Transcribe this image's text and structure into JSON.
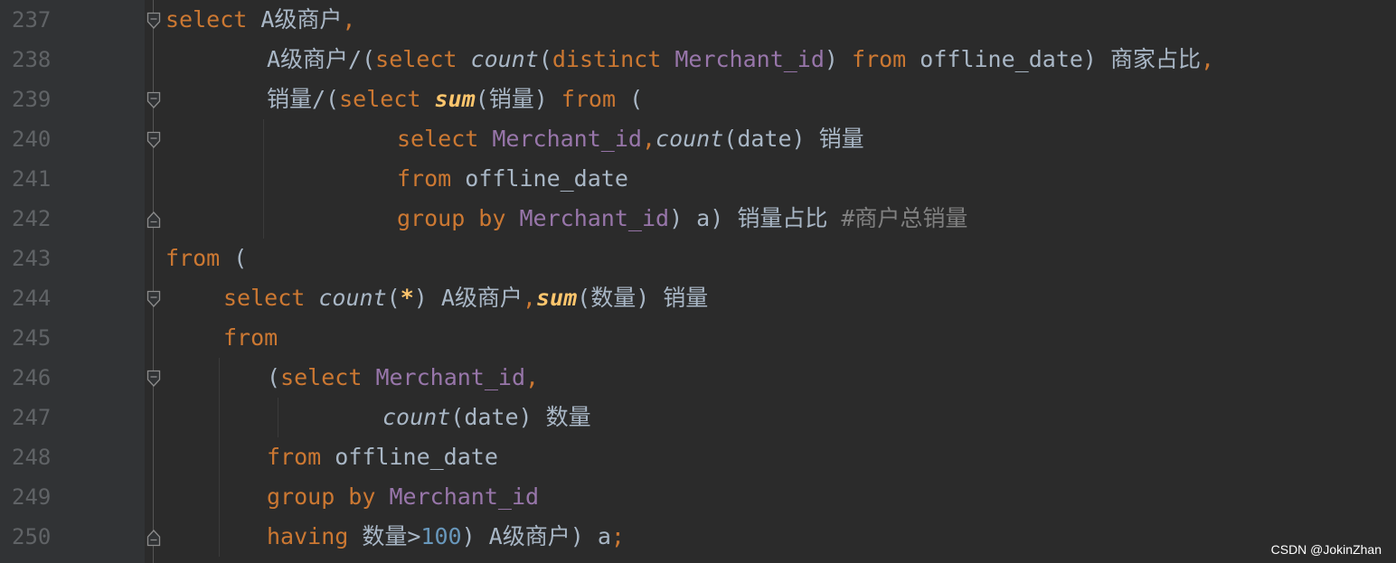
{
  "editor": {
    "lines": [
      {
        "num": "237",
        "fold": "start",
        "indent": 0,
        "tokens": [
          [
            "select",
            "kw"
          ],
          [
            " A级商户",
            "txt"
          ],
          [
            ",",
            "kw"
          ]
        ]
      },
      {
        "num": "238",
        "fold": "",
        "indent": 2,
        "tokens": [
          [
            "A级商户/(",
            "txt"
          ],
          [
            "select",
            "kw"
          ],
          [
            " ",
            "txt"
          ],
          [
            "count",
            "fn"
          ],
          [
            "(",
            "txt"
          ],
          [
            "distinct",
            "kw"
          ],
          [
            " ",
            "txt"
          ],
          [
            "Merchant_id",
            "col"
          ],
          [
            ") ",
            "txt"
          ],
          [
            "from",
            "kw"
          ],
          [
            " offline_date) 商家占比",
            "txt"
          ],
          [
            ",",
            "kw"
          ]
        ]
      },
      {
        "num": "239",
        "fold": "start",
        "indent": 2,
        "tokens": [
          [
            "销量/(",
            "txt"
          ],
          [
            "select",
            "kw"
          ],
          [
            " ",
            "txt"
          ],
          [
            "sum",
            "fa"
          ],
          [
            "(销量) ",
            "txt"
          ],
          [
            "from",
            "kw"
          ],
          [
            " (",
            "txt"
          ]
        ]
      },
      {
        "num": "240",
        "fold": "start",
        "indent": 4,
        "tokens": [
          [
            "select",
            "kw"
          ],
          [
            " ",
            "txt"
          ],
          [
            "Merchant_id",
            "col"
          ],
          [
            ",",
            "kw"
          ],
          [
            "count",
            "fn"
          ],
          [
            "(date) 销量",
            "txt"
          ]
        ]
      },
      {
        "num": "241",
        "fold": "",
        "indent": 4,
        "tokens": [
          [
            "from",
            "kw"
          ],
          [
            " offline_date",
            "txt"
          ]
        ]
      },
      {
        "num": "242",
        "fold": "end",
        "indent": 4,
        "tokens": [
          [
            "group by",
            "kw"
          ],
          [
            " ",
            "txt"
          ],
          [
            "Merchant_id",
            "col"
          ],
          [
            ") a) 销量占比 ",
            "txt"
          ],
          [
            "#商户总销量",
            "cmt"
          ]
        ]
      },
      {
        "num": "243",
        "fold": "",
        "indent": 0,
        "tokens": [
          [
            "from",
            "kw"
          ],
          [
            " (",
            "txt"
          ]
        ]
      },
      {
        "num": "244",
        "fold": "start",
        "indent": 1,
        "tokens": [
          [
            "select",
            "kw"
          ],
          [
            " ",
            "txt"
          ],
          [
            "count",
            "fn"
          ],
          [
            "(",
            "txt"
          ],
          [
            "*",
            "fa"
          ],
          [
            ") A级商户",
            "txt"
          ],
          [
            ",",
            "kw"
          ],
          [
            "sum",
            "fa"
          ],
          [
            "(数量) 销量",
            "txt"
          ]
        ]
      },
      {
        "num": "245",
        "fold": "",
        "indent": 1,
        "tokens": [
          [
            "from",
            "kw"
          ]
        ]
      },
      {
        "num": "246",
        "fold": "start",
        "indent": 2,
        "tokens": [
          [
            "(",
            "txt"
          ],
          [
            "select",
            "kw"
          ],
          [
            " ",
            "txt"
          ],
          [
            "Merchant_id",
            "col"
          ],
          [
            ",",
            "kw"
          ]
        ]
      },
      {
        "num": "247",
        "fold": "",
        "indent": 3,
        "tokens": [
          [
            "count",
            "fn"
          ],
          [
            "(date) 数量",
            "txt"
          ]
        ]
      },
      {
        "num": "248",
        "fold": "",
        "indent": 2,
        "tokens": [
          [
            "from",
            "kw"
          ],
          [
            " offline_date",
            "txt"
          ]
        ]
      },
      {
        "num": "249",
        "fold": "",
        "indent": 2,
        "tokens": [
          [
            "group by",
            "kw"
          ],
          [
            " ",
            "txt"
          ],
          [
            "Merchant_id",
            "col"
          ]
        ]
      },
      {
        "num": "250",
        "fold": "end",
        "indent": 2,
        "tokens": [
          [
            "having",
            "kw"
          ],
          [
            " 数量>",
            "txt"
          ],
          [
            "100",
            "num"
          ],
          [
            ") A级商户) a",
            "txt"
          ],
          [
            ";",
            "kw"
          ]
        ]
      }
    ]
  },
  "colors": {
    "background": "#2b2b2b",
    "gutter": "#313335",
    "keyword": "#cc7832",
    "identifier": "#a9b7c6",
    "column": "#9876aa",
    "aggregate": "#ffc66d",
    "number": "#6897bb",
    "comment": "#808080",
    "line_number": "#606366"
  },
  "watermark": "CSDN @JokinZhan"
}
